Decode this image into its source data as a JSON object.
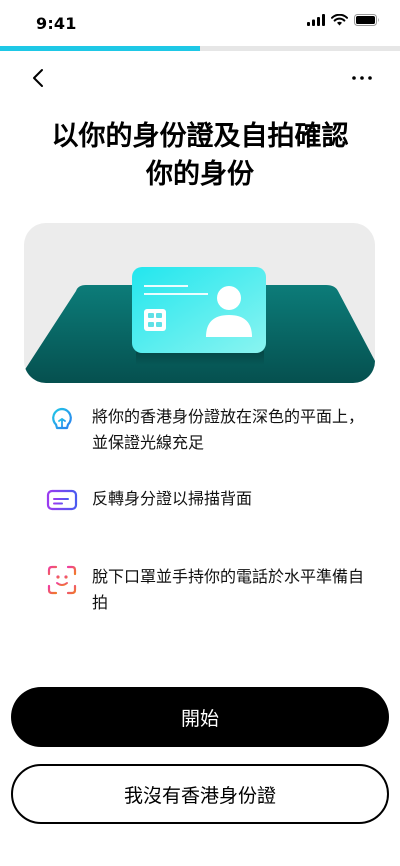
{
  "status_bar": {
    "time": "9:41",
    "icons": [
      "cellular-signal-icon",
      "wifi-icon",
      "battery-icon"
    ]
  },
  "progress": {
    "fraction": 0.5,
    "color": "#1ec8e6"
  },
  "nav": {
    "back_icon": "chevron-left-icon",
    "more_icon": "more-horizontal-icon"
  },
  "title": {
    "line1": "以你的身份證及自拍確認",
    "line2": "你的身份"
  },
  "tips": [
    {
      "icon": "lightbulb-icon",
      "text": "將你的香港身份證放在深色的平面上，並保證光線充足"
    },
    {
      "icon": "card-flip-icon",
      "text": "反轉身分證以掃描背面"
    },
    {
      "icon": "face-scan-icon",
      "text": "脫下口罩並手持你的電話於水平準備自拍"
    }
  ],
  "buttons": {
    "start": "開始",
    "no_id": "我沒有香港身份證"
  }
}
